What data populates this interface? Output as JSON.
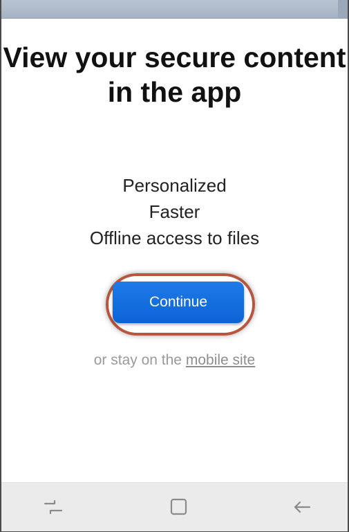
{
  "screen": {
    "title": "View your secure content in the app",
    "features": [
      "Personalized",
      "Faster",
      "Offline access to files"
    ],
    "continue_label": "Continue",
    "stay_prefix": "or stay on the",
    "stay_link": "mobile site"
  },
  "nav": {
    "recent_icon": "recent-apps-icon",
    "home_icon": "home-icon",
    "back_icon": "back-arrow-icon"
  },
  "colors": {
    "button": "#1268de",
    "highlight_ring": "#b8553f",
    "nav_background": "#ebebeb"
  }
}
